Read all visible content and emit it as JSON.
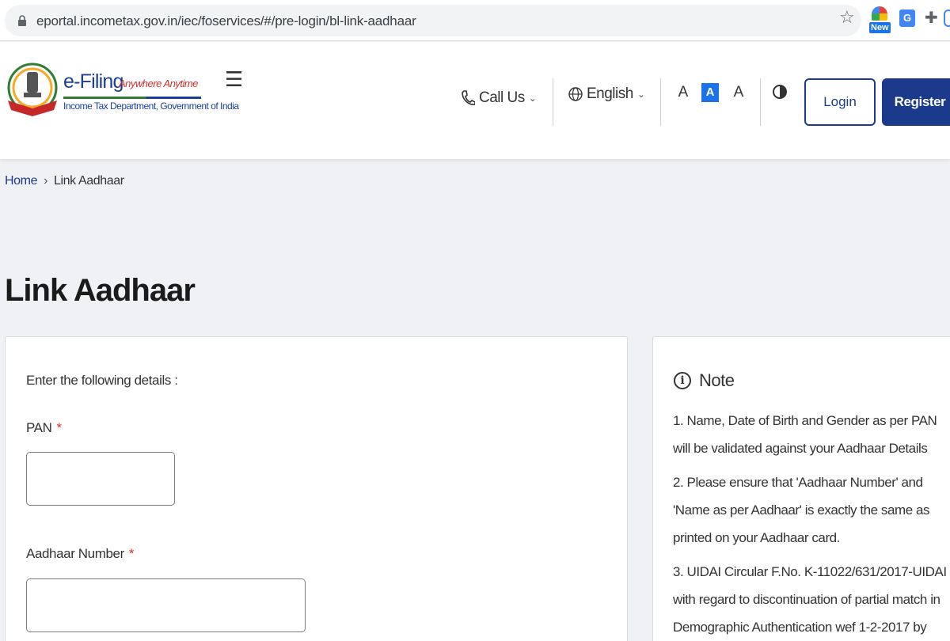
{
  "browser": {
    "url": "eportal.incometax.gov.in/iec/foservices/#/pre-login/bl-link-aadhaar",
    "ext_badge": "New",
    "translate_glyph": "G"
  },
  "header": {
    "brand": "e-Filing",
    "tagline": "Anywhere Anytime",
    "department": "Income Tax Department, Government of India",
    "call_us": "Call Us",
    "language": "English",
    "font_decrease": "A",
    "font_normal": "A",
    "font_increase": "A",
    "login": "Login",
    "register": "Register"
  },
  "breadcrumb": {
    "home": "Home",
    "separator": "›",
    "current": "Link Aadhaar"
  },
  "page": {
    "title": "Link Aadhaar"
  },
  "form": {
    "intro": "Enter the following details :",
    "pan_label": "PAN",
    "aadhaar_label": "Aadhaar Number",
    "required_marker": "*",
    "pan_value": "",
    "aadhaar_value": ""
  },
  "note": {
    "title": "Note",
    "items": [
      "1. Name, Date of Birth and Gender as per PAN will be validated against your Aadhaar Details",
      "2. Please ensure that 'Aadhaar Number' and 'Name as per Aadhaar' is exactly the same as printed on your Aadhaar card.",
      "3. UIDAI Circular F.No. K-11022/631/2017-UIDAI with regard to discontinuation of partial match in Demographic Authentication wef 1-2-2017 by"
    ]
  },
  "colors": {
    "primary": "#1b3a8b",
    "required": "#d32f2f",
    "page_bg": "#f0f1f5"
  }
}
